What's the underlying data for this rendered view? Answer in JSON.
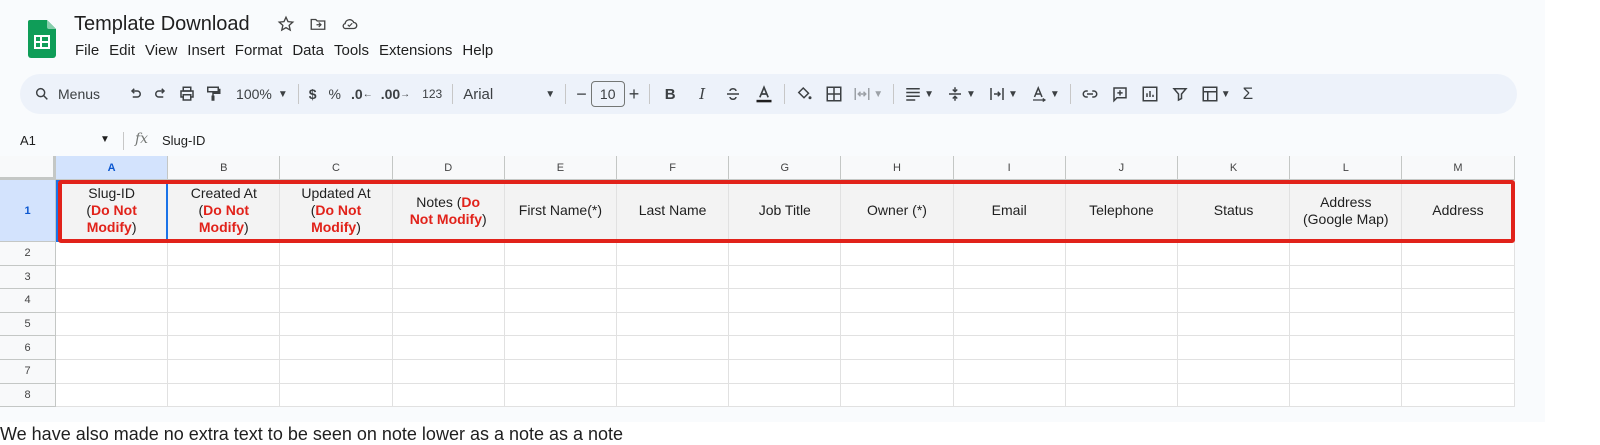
{
  "doc": {
    "title": "Template Download",
    "icons": [
      "star-icon",
      "move-to-folder-icon",
      "cloud-saved-icon"
    ]
  },
  "menu": [
    "File",
    "Edit",
    "View",
    "Insert",
    "Format",
    "Data",
    "Tools",
    "Extensions",
    "Help"
  ],
  "toolbar": {
    "search_label": "Menus",
    "zoom": "100%",
    "currency": "$",
    "percent": "%",
    "dec_decrease": ".0",
    "dec_increase": ".00",
    "number_format": "123",
    "font": "Arial",
    "font_size": "10",
    "minus": "−",
    "plus": "+",
    "bold": "B",
    "italic": "I"
  },
  "formula_bar": {
    "name_box": "A1",
    "fx": "fx",
    "value": "Slug-ID"
  },
  "columns": [
    "A",
    "B",
    "C",
    "D",
    "E",
    "F",
    "G",
    "H",
    "I",
    "J",
    "K",
    "L",
    "M"
  ],
  "rows": [
    "1",
    "2",
    "3",
    "4",
    "5",
    "6",
    "7",
    "8"
  ],
  "header_cells": [
    {
      "col": "A",
      "line1": "Slug-ID",
      "red": "Do Not Modify",
      "pre": "(",
      "post": ")"
    },
    {
      "col": "B",
      "line1": "Created At",
      "red": "Do Not Modify",
      "pre": "(",
      "post": ")"
    },
    {
      "col": "C",
      "line1": "Updated At",
      "red": "Do Not Modify",
      "pre": "(",
      "post": ")"
    },
    {
      "col": "D",
      "line1": "Notes (",
      "red": "Do Not Modify",
      "post": ")",
      "inline": true
    },
    {
      "col": "E",
      "text": "First Name(*)"
    },
    {
      "col": "F",
      "text": "Last Name"
    },
    {
      "col": "G",
      "text": "Job Title"
    },
    {
      "col": "H",
      "text": "Owner (*)"
    },
    {
      "col": "I",
      "text": "Email"
    },
    {
      "col": "J",
      "text": "Telephone"
    },
    {
      "col": "K",
      "text": "Status"
    },
    {
      "col": "L",
      "text": "Address (Google Map)"
    },
    {
      "col": "M",
      "text": "Address"
    }
  ],
  "caption": "We have also made no extra text to be seen on note lower as a note as a note",
  "colors": {
    "accent": "#1a73e8",
    "highlight": "#e1221a",
    "sheets_green": "#0f9d58"
  }
}
